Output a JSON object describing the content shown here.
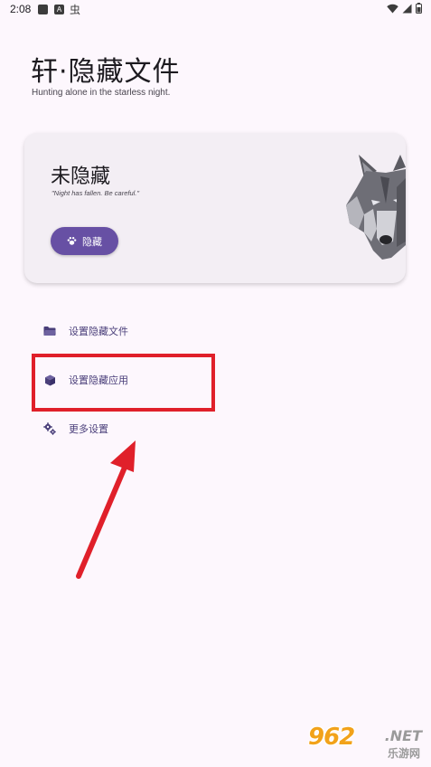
{
  "status_bar": {
    "time": "2:08",
    "icons": [
      "square-notification-icon",
      "a-notification-icon",
      "bug-notification-icon"
    ],
    "right_icons": [
      "wifi-icon",
      "signal-icon",
      "battery-icon"
    ],
    "a_badge": "A",
    "bug_glyph": "虫"
  },
  "header": {
    "title": "轩·隐藏文件",
    "subtitle": "Hunting alone in the starless night."
  },
  "status_card": {
    "title": "未隐藏",
    "quote": "\"Night has fallen. Be careful.\"",
    "button_label": "隐藏",
    "button_icon": "paw-icon",
    "image": "wolf-icon"
  },
  "menu": {
    "items": [
      {
        "label": "设置隐藏文件",
        "icon": "folder-icon"
      },
      {
        "label": "设置隐藏应用",
        "icon": "cube-icon"
      },
      {
        "label": "更多设置",
        "icon": "gears-icon"
      }
    ]
  },
  "annotation": {
    "highlight_color": "#e0202a"
  },
  "watermark": {
    "logo": "962",
    "domain": ".NET",
    "subtitle": "乐游网"
  },
  "colors": {
    "background": "#fdf7fd",
    "card": "#f3eef4",
    "accent": "#6750a4",
    "menu_text": "#4a3f7a"
  }
}
